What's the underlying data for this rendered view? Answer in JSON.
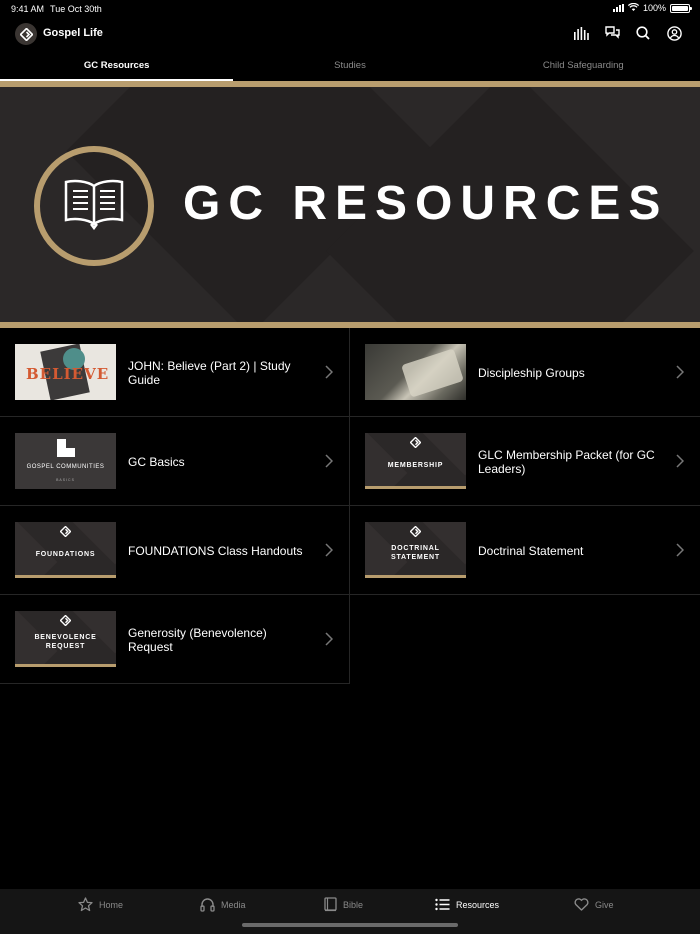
{
  "status_bar": {
    "time": "9:41 AM",
    "date": "Tue Oct 30th",
    "battery": "100%",
    "battery_level": 1.0
  },
  "header": {
    "title": "Gospel Life",
    "icons": [
      "audio-levels-icon",
      "chat-bubbles-icon",
      "search-icon",
      "account-icon"
    ]
  },
  "top_tabs": [
    {
      "label": "GC Resources",
      "active": true
    },
    {
      "label": "Studies",
      "active": false
    },
    {
      "label": "Child Safeguarding",
      "active": false
    }
  ],
  "banner": {
    "title": "GC RESOURCES",
    "icon": "open-book-icon",
    "accent": "#b89d6e"
  },
  "resources": [
    {
      "title": "JOHN: Believe (Part 2) | Study Guide",
      "thumb_text": "BELIEVE"
    },
    {
      "title": "Discipleship Groups"
    },
    {
      "title": "GC Basics",
      "thumb_text": "GOSPEL COMMUNITIES",
      "thumb_sub": "BASICS"
    },
    {
      "title": "GLC Membership Packet (for GC Leaders)",
      "thumb_text": "MEMBERSHIP"
    },
    {
      "title": "FOUNDATIONS Class Handouts",
      "thumb_text": "FOUNDATIONS"
    },
    {
      "title": "Doctrinal Statement",
      "thumb_text": "DOCTRINAL STATEMENT"
    },
    {
      "title": "Generosity (Benevolence) Request",
      "thumb_text": "BENEVOLENCE REQUEST"
    }
  ],
  "bottom_tabs": [
    {
      "label": "Home",
      "icon": "star-icon",
      "active": false
    },
    {
      "label": "Media",
      "icon": "headphones-icon",
      "active": false
    },
    {
      "label": "Bible",
      "icon": "book-icon",
      "active": false
    },
    {
      "label": "Resources",
      "icon": "list-icon",
      "active": true
    },
    {
      "label": "Give",
      "icon": "heart-icon",
      "active": false
    }
  ]
}
